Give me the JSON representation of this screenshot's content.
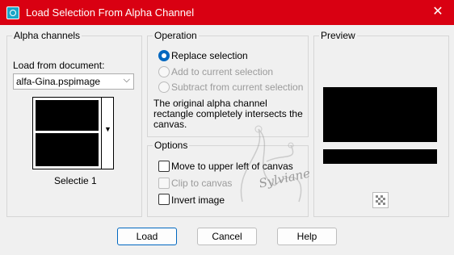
{
  "window": {
    "title": "Load Selection From Alpha Channel",
    "close_glyph": "✕",
    "icon": "alpha-channel-app-icon"
  },
  "alpha_channels": {
    "group_label": "Alpha channels",
    "load_from_label": "Load from document:",
    "document_value": "alfa-Gina.pspimage",
    "selected_channel": "Selectie 1"
  },
  "operation": {
    "group_label": "Operation",
    "options": [
      {
        "label": "Replace selection",
        "selected": true,
        "enabled": true
      },
      {
        "label": "Add to current selection",
        "selected": false,
        "enabled": false
      },
      {
        "label": "Subtract from current selection",
        "selected": false,
        "enabled": false
      }
    ],
    "info_text": "The original alpha channel rectangle completely intersects the canvas."
  },
  "options": {
    "group_label": "Options",
    "checkboxes": [
      {
        "label": "Move to upper left of canvas",
        "checked": false,
        "enabled": true
      },
      {
        "label": "Clip to canvas",
        "checked": false,
        "enabled": false
      },
      {
        "label": "Invert image",
        "checked": false,
        "enabled": true
      }
    ]
  },
  "preview": {
    "group_label": "Preview",
    "transparency_icon": "checkerboard-icon"
  },
  "watermark": {
    "text": "Sylviane"
  },
  "buttons": {
    "load": "Load",
    "cancel": "Cancel",
    "help": "Help"
  },
  "colors": {
    "titlebar": "#d90012",
    "accent": "#0067c0"
  }
}
